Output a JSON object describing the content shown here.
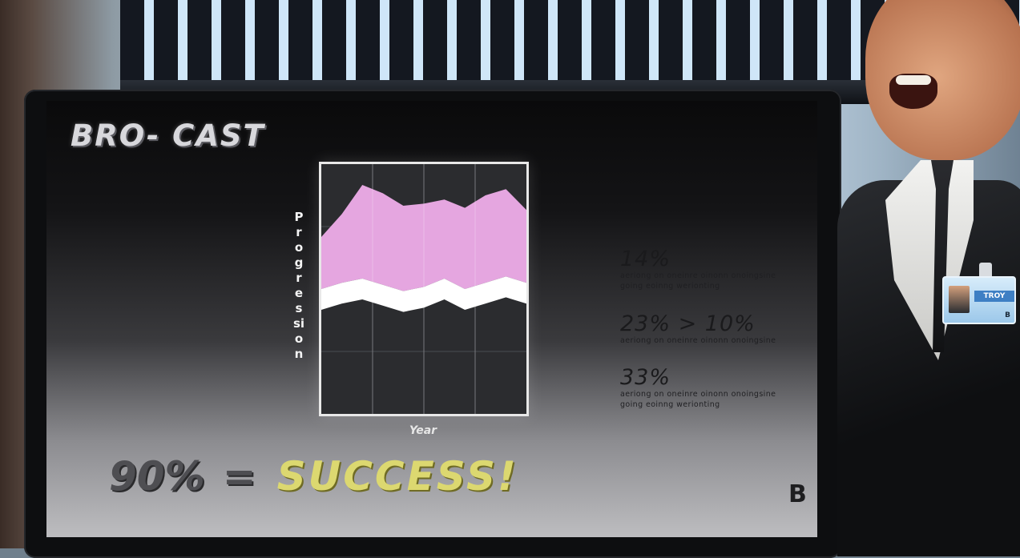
{
  "screen": {
    "logo": "BRO- CAST",
    "chart": {
      "y_label": "Progression",
      "x_label": "Year"
    },
    "stats": [
      {
        "value": "14%",
        "text": "aeriong on oneinre oinonn onoingsine going eoinng werionting"
      },
      {
        "value": "23% > 10%",
        "text": "aeriong on oneinre oinonn onoingsine"
      },
      {
        "value": "33%",
        "text": "aeriong on oneinre oinonn onoingsine going eoinng werionting"
      }
    ],
    "headline": {
      "percent": "90%",
      "equals": "=",
      "word": "SUCCESS!"
    },
    "corner_logo": "B"
  },
  "badge": {
    "name": "TROY",
    "letter": "B"
  },
  "chart_data": {
    "type": "area",
    "x": [
      0,
      1,
      2,
      3,
      4,
      5,
      6,
      7,
      8,
      9,
      10
    ],
    "series": [
      {
        "values": [
          10,
          13,
          15,
          12,
          9,
          11,
          15,
          10,
          13,
          16,
          13
        ],
        "color": "#ffffff"
      },
      {
        "values": [
          35,
          46,
          60,
          56,
          50,
          51,
          53,
          49,
          55,
          58,
          48
        ],
        "color": "#e5a6e0"
      }
    ],
    "ylim": [
      -50,
      70
    ],
    "grid": true
  }
}
